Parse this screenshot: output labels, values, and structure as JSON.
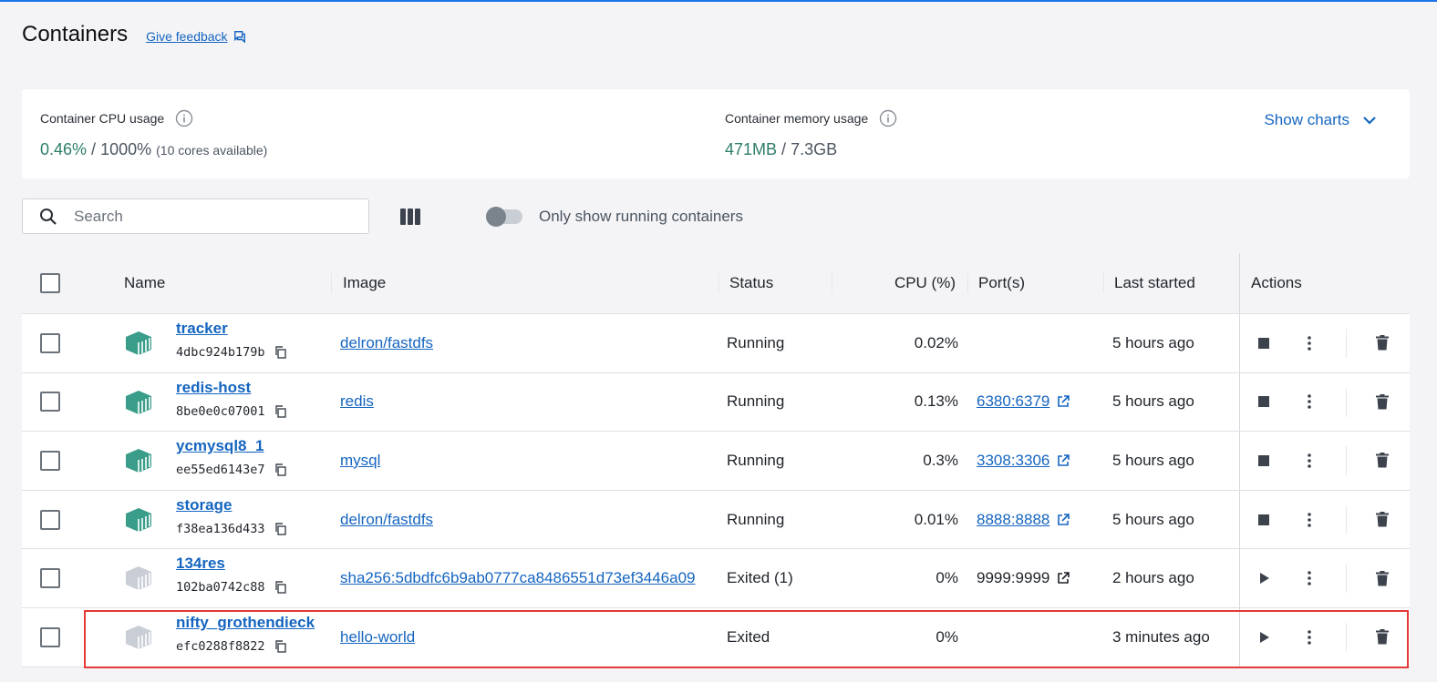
{
  "header": {
    "title": "Containers",
    "feedback_label": "Give feedback"
  },
  "stats": {
    "cpu_label": "Container CPU usage",
    "cpu_used": "0.46%",
    "cpu_sep": " / ",
    "cpu_total": "1000%",
    "cpu_note": "(10 cores available)",
    "mem_label": "Container memory usage",
    "mem_used": "471MB",
    "mem_sep": " / ",
    "mem_total": "7.3GB",
    "show_charts_label": "Show charts"
  },
  "toolbar": {
    "search_placeholder": "Search",
    "toggle_label": "Only show running containers"
  },
  "table": {
    "columns": {
      "name": "Name",
      "image": "Image",
      "status": "Status",
      "cpu": "CPU (%)",
      "ports": "Port(s)",
      "last_started": "Last started",
      "actions": "Actions"
    },
    "rows": [
      {
        "name": "tracker",
        "id": "4dbc924b179b",
        "image": "delron/fastdfs",
        "status": "Running",
        "cpu": "0.02%",
        "port": "",
        "last_started": "5 hours ago",
        "running": true
      },
      {
        "name": "redis-host",
        "id": "8be0e0c07001",
        "image": "redis",
        "status": "Running",
        "cpu": "0.13%",
        "port": "6380:6379",
        "last_started": "5 hours ago",
        "running": true
      },
      {
        "name": "ycmysql8_1",
        "id": "ee55ed6143e7",
        "image": "mysql",
        "status": "Running",
        "cpu": "0.3%",
        "port": "3308:3306",
        "last_started": "5 hours ago",
        "running": true
      },
      {
        "name": "storage",
        "id": "f38ea136d433",
        "image": "delron/fastdfs",
        "status": "Running",
        "cpu": "0.01%",
        "port": "8888:8888",
        "last_started": "5 hours ago",
        "running": true
      },
      {
        "name": "134res",
        "id": "102ba0742c88",
        "image": "sha256:5dbdfc6b9ab0777ca8486551d73ef3446a09",
        "status": "Exited (1)",
        "cpu": "0%",
        "port": "9999:9999",
        "last_started": "2 hours ago",
        "running": false
      },
      {
        "name": "nifty_grothendieck",
        "id": "efc0288f8822",
        "image": "hello-world",
        "status": "Exited",
        "cpu": "0%",
        "port": "",
        "last_started": "3 minutes ago",
        "running": false
      }
    ]
  },
  "colors": {
    "accent": "#1565c0",
    "running_icon": "#3a9d8a",
    "exited_icon": "#c9ced6",
    "highlight": "#e53935"
  }
}
